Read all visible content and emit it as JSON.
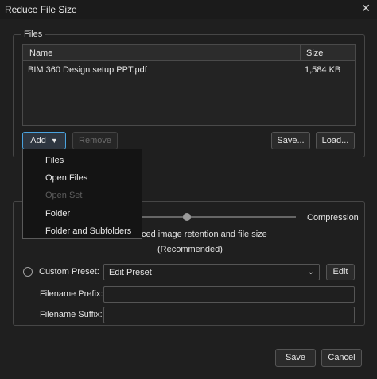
{
  "window": {
    "title": "Reduce File Size"
  },
  "files_group": {
    "label": "Files",
    "columns": {
      "name": "Name",
      "size": "Size"
    },
    "rows": [
      {
        "name": "BIM 360 Design setup PPT.pdf",
        "size": "1,584 KB"
      }
    ],
    "buttons": {
      "add": "Add",
      "remove": "Remove",
      "save": "Save...",
      "load": "Load..."
    }
  },
  "add_menu": {
    "items": [
      {
        "label": "Files",
        "enabled": true
      },
      {
        "label": "Open Files",
        "enabled": true
      },
      {
        "label": "Open Set",
        "enabled": false
      },
      {
        "label": "Folder",
        "enabled": true
      },
      {
        "label": "Folder and Subfolders",
        "enabled": true
      }
    ]
  },
  "options": {
    "compression_label": "Compression",
    "balance_text": "ced image retention and file size",
    "recommended_text": "(Recommended)",
    "custom_preset_label": "Custom Preset:",
    "preset_value": "Edit Preset",
    "edit_button": "Edit",
    "filename_prefix_label": "Filename Prefix:",
    "filename_suffix_label": "Filename Suffix:",
    "filename_prefix_value": "",
    "filename_suffix_value": ""
  },
  "footer": {
    "save": "Save",
    "cancel": "Cancel"
  },
  "colors": {
    "accent": "#4aa3df",
    "background": "#1f1f1f"
  },
  "icons": {
    "close": "close-icon",
    "dropdown": "chevron-down-icon"
  }
}
